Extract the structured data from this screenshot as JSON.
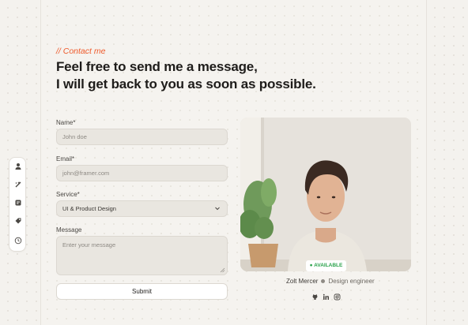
{
  "header": {
    "kicker": "// Contact me",
    "headline_line1": "Feel free to send me a message,",
    "headline_line2": "I will get back to you as soon as possible."
  },
  "form": {
    "name_label": "Name*",
    "name_placeholder": "John doe",
    "email_label": "Email*",
    "email_placeholder": "john@framer.com",
    "service_label": "Service*",
    "service_value": "UI & Product Design",
    "message_label": "Message",
    "message_placeholder": "Enter your message",
    "submit_label": "Submit"
  },
  "profile": {
    "badge": "AVAILABLE",
    "name": "Zolt Mercer",
    "role": "Design engineer",
    "socials": [
      "github-icon",
      "linkedin-icon",
      "instagram-icon"
    ]
  },
  "sidebar": {
    "icons": [
      "user-icon",
      "sparkle-icon",
      "doc-icon",
      "tag-icon",
      "clock-icon"
    ]
  },
  "colors": {
    "accent": "#ef5a2b",
    "available": "#2aa24b",
    "background": "#f4f2ee"
  }
}
